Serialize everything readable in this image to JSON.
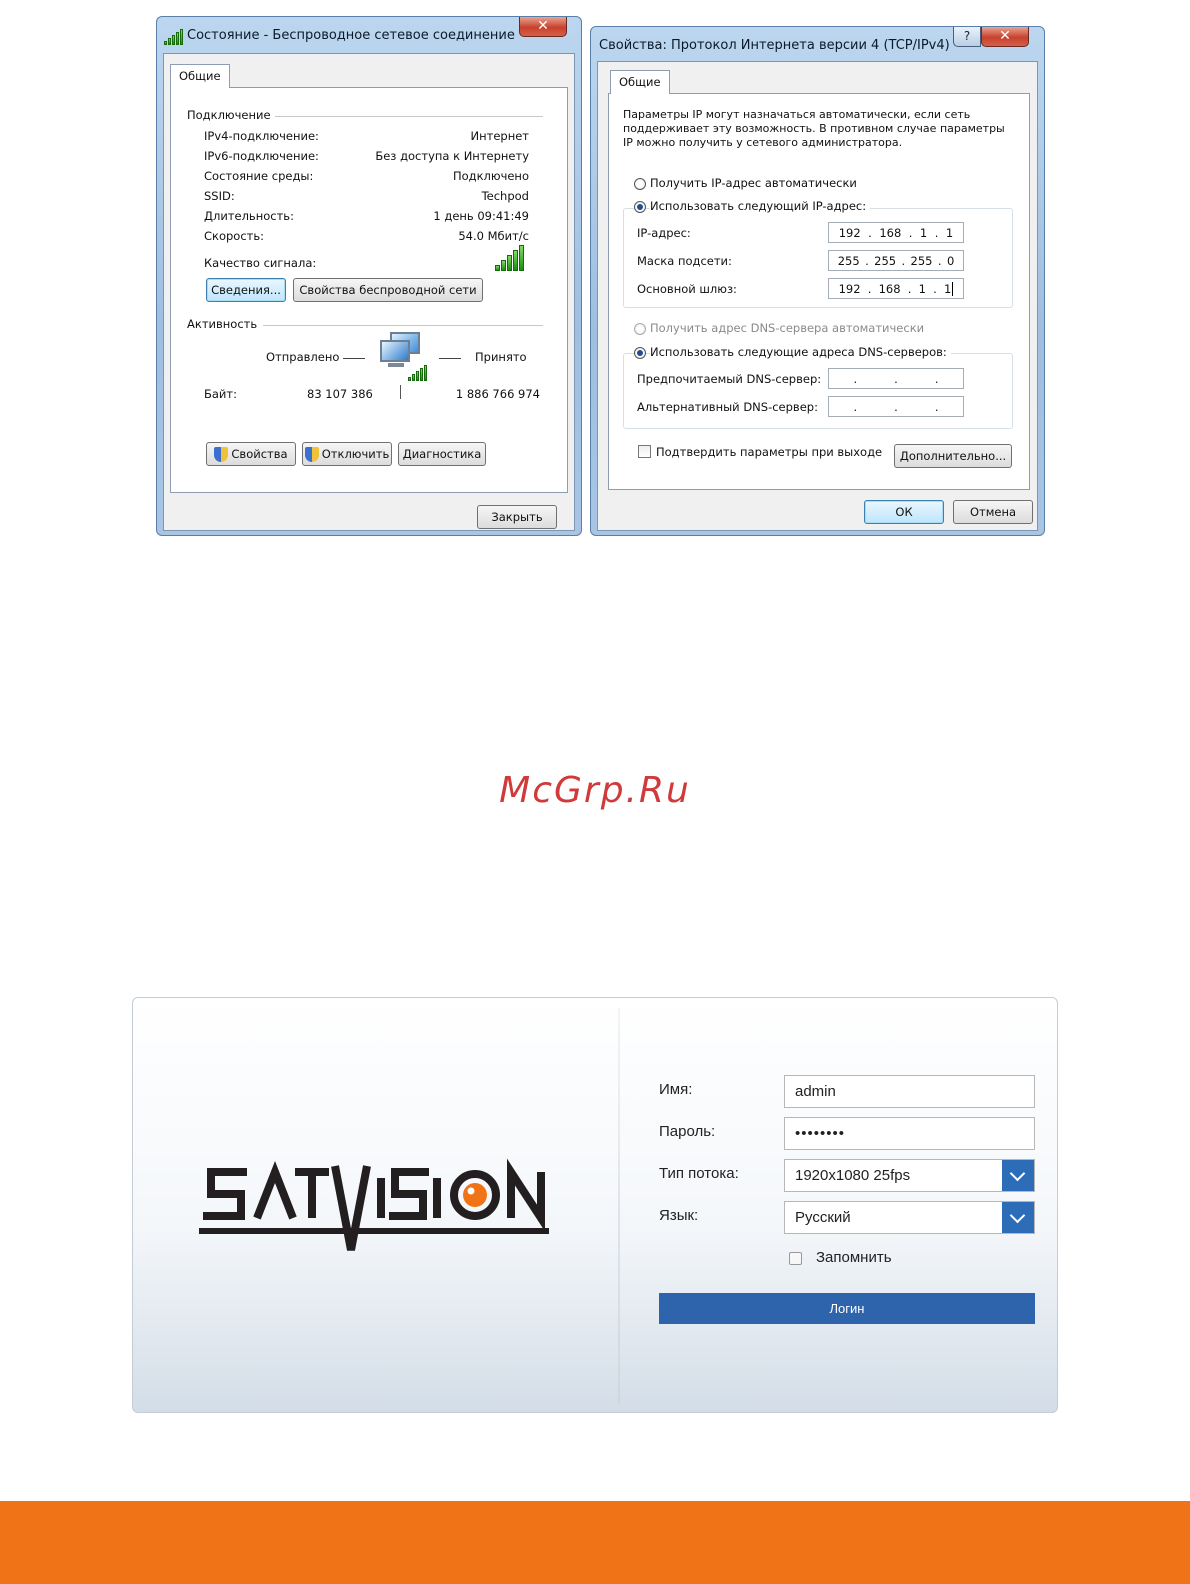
{
  "status_dialog": {
    "title": "Состояние - Беспроводное сетевое соединение",
    "close_glyph": "✕",
    "tab": "Общие",
    "connection_group": "Подключение",
    "rows": [
      {
        "label": "IPv4-подключение:",
        "value": "Интернет"
      },
      {
        "label": "IPv6-подключение:",
        "value": "Без доступа к Интернету"
      },
      {
        "label": "Состояние среды:",
        "value": "Подключено"
      },
      {
        "label": "SSID:",
        "value": "Techpod"
      },
      {
        "label": "Длительность:",
        "value": "1 день 09:41:49"
      },
      {
        "label": "Скорость:",
        "value": "54.0 Мбит/с"
      }
    ],
    "signal_label": "Качество сигнала:",
    "details_button": "Сведения...",
    "wireless_props_button": "Свойства беспроводной сети",
    "activity_group": "Активность",
    "sent_label": "Отправлено",
    "received_label": "Принято",
    "bytes_label": "Байт:",
    "bytes_sent": "83 107 386",
    "bytes_received": "1 886 766 974",
    "properties_button": "Свойства",
    "disable_button": "Отключить",
    "diagnose_button": "Диагностика",
    "close_button": "Закрыть"
  },
  "ipv4_dialog": {
    "title": "Свойства: Протокол Интернета версии 4 (TCP/IPv4)",
    "help_glyph": "?",
    "close_glyph": "✕",
    "tab": "Общие",
    "description_lines": [
      "Параметры IP могут назначаться автоматически, если сеть",
      "поддерживает эту возможность. В противном случае параметры",
      "IP можно получить у сетевого администратора."
    ],
    "auto_ip_label": "Получить IP-адрес автоматически",
    "manual_ip_label": "Использовать следующий IP-адрес:",
    "ip_label": "IP-адрес:",
    "ip_value": [
      "192",
      "168",
      "1",
      "1"
    ],
    "mask_label": "Маска подсети:",
    "mask_value": [
      "255",
      "255",
      "255",
      "0"
    ],
    "gateway_label": "Основной шлюз:",
    "gateway_value": [
      "192",
      "168",
      "1",
      "1"
    ],
    "auto_dns_label": "Получить адрес DNS-сервера автоматически",
    "manual_dns_label": "Использовать следующие адреса DNS-серверов:",
    "preferred_dns_label": "Предпочитаемый DNS-сервер:",
    "alternate_dns_label": "Альтернативный DNS-сервер:",
    "validate_label": "Подтвердить параметры при выходе",
    "advanced_button": "Дополнительно...",
    "ok_button": "ОК",
    "cancel_button": "Отмена"
  },
  "watermark": "McGrp.Ru",
  "login": {
    "logo_text": "SATVISION",
    "name_label": "Имя:",
    "name_value": "admin",
    "password_label": "Пароль:",
    "password_value": "••••••••",
    "stream_label": "Тип потока:",
    "stream_value": "1920x1080 25fps",
    "language_label": "Язык:",
    "language_value": "Русский",
    "remember_label": "Запомнить",
    "login_button": "Логин"
  },
  "colors": {
    "accent_blue": "#2d64ab",
    "footer_orange": "#f07417",
    "watermark_red": "#d03a3a",
    "logo_orange": "#f07417"
  }
}
